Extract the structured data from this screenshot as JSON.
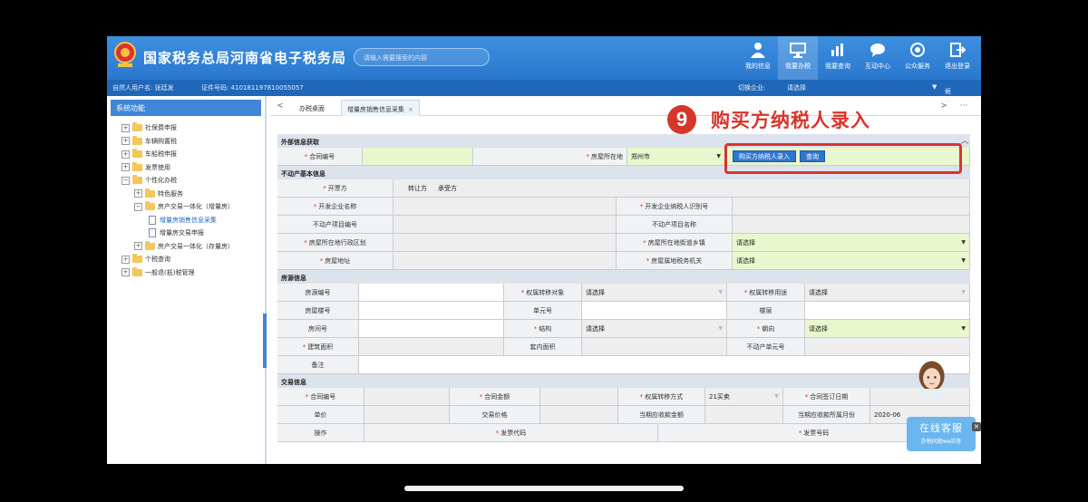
{
  "header": {
    "title": "国家税务总局河南省电子税务局",
    "search_placeholder": "请输入需要搜索的内容",
    "nav": [
      {
        "label": "我的信息",
        "icon": "user-icon"
      },
      {
        "label": "我要办税",
        "icon": "monitor-icon"
      },
      {
        "label": "我要查询",
        "icon": "chart-search-icon"
      },
      {
        "label": "互动中心",
        "icon": "chat-icon"
      },
      {
        "label": "公众服务",
        "icon": "service-icon"
      },
      {
        "label": "退出登录",
        "icon": "logout-icon"
      }
    ]
  },
  "userbar": {
    "user": "自然人用户名: 张廷发",
    "idno": "证件号码: 410181197810055057",
    "switch_label": "切换企业:",
    "switch_value": "请选择",
    "back": "返回"
  },
  "sidebar": {
    "title": "系统功能",
    "items": [
      {
        "label": "社保费申报",
        "level": 1,
        "expand": "+"
      },
      {
        "label": "车辆购置税",
        "level": 1,
        "expand": "+"
      },
      {
        "label": "车船税申报",
        "level": 1,
        "expand": "+"
      },
      {
        "label": "发票使用",
        "level": 1,
        "expand": "+"
      },
      {
        "label": "个性化办税",
        "level": 1,
        "expand": "−"
      },
      {
        "label": "特色服务",
        "level": 2,
        "expand": "+"
      },
      {
        "label": "房产交易一体化（增量房）",
        "level": 2,
        "expand": "−"
      },
      {
        "label": "增量房销售信息采集",
        "level": 3,
        "selected": true
      },
      {
        "label": "增量房交易申报",
        "level": 3
      },
      {
        "label": "房产交易一体化（存量房）",
        "level": 2,
        "expand": "+"
      },
      {
        "label": "个税查询",
        "level": 1,
        "expand": "+"
      },
      {
        "label": "一般退(抵)税管理",
        "level": 1,
        "expand": "+"
      }
    ]
  },
  "tabs": {
    "left_arrow": "<",
    "right_arrow": ">",
    "more": "···",
    "items": [
      {
        "label": "办税桌面"
      },
      {
        "label": "增量房销售信息采集",
        "active": true,
        "close": "×"
      }
    ]
  },
  "annotation": {
    "number": "9",
    "text": "购买方纳税人录入"
  },
  "form": {
    "sec1": "外部信息获取",
    "contract_no": "合同编号",
    "house_location": "房屋所在地",
    "house_location_value": "郑州市",
    "btn_buyer": "购买方纳税人录入",
    "btn_query": "查询",
    "sec2": "不动产基本信息",
    "open_party": "开票方",
    "opt_seller": "转让方",
    "opt_buyer": "承受方",
    "dev_name": "开发企业名称",
    "dev_taxid": "开发企业纳税人识别号",
    "proj_no": "不动产项目编号",
    "proj_name": "不动产项目名称",
    "admin_area": "房屋所在地行政区划",
    "street": "房屋所在地街道乡镇",
    "street_value": "请选择",
    "address": "房屋地址",
    "tax_office": "房屋属地税务机关",
    "tax_office_value": "请选择",
    "sec3": "房源信息",
    "house_no": "房源编号",
    "transfer_obj": "权属转移对象",
    "transfer_obj_value": "请选择",
    "transfer_use": "权属转移用途",
    "transfer_use_value": "请选择",
    "building_no": "房屋楼号",
    "unit_no": "单元号",
    "floor": "楼层",
    "room_no": "房间号",
    "structure": "结构",
    "structure_value": "请选择",
    "orientation": "朝向",
    "orientation_value": "请选择",
    "build_area": "建筑面积",
    "inner_area": "套内面积",
    "unit_code": "不动产单元号",
    "remark": "备注",
    "sec4": "交易信息",
    "contract_no2": "合同编号",
    "contract_amount": "合同金额",
    "transfer_method": "权属转移方式",
    "transfer_method_value": "21买卖",
    "sign_date": "合同签订日期",
    "unit_price": "单价",
    "trade_price": "交易价格",
    "period_amount": "当期应收款金额",
    "period_month": "当期应收款所属月份",
    "period_month_value": "2020-06",
    "op": "操作",
    "invoice_code": "发票代码",
    "invoice_no": "发票号码"
  },
  "service": {
    "title": "在线客服",
    "sub": "办税问题we应答",
    "close": "×"
  },
  "colors": {
    "header_blue": "#2a78cf",
    "accent_red": "#d8352b",
    "field_green": "#e8f7cd"
  }
}
